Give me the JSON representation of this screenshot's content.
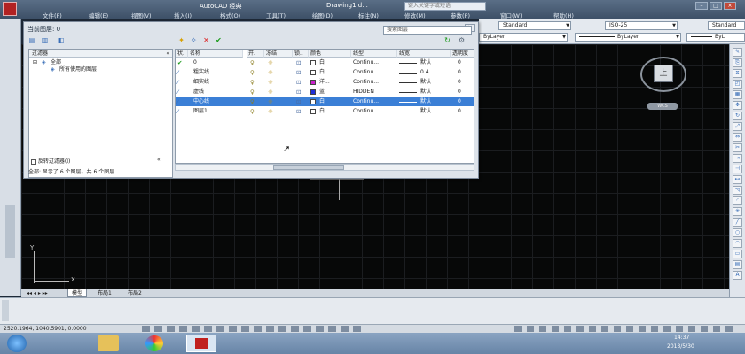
{
  "app": {
    "title": "AutoCAD 经典",
    "document": "Drawing1.d...",
    "search_placeholder": "键入关键字或短语",
    "menus": [
      "文件(F)",
      "编辑(E)",
      "视图(V)",
      "插入(I)",
      "格式(O)",
      "工具(T)",
      "绘图(D)",
      "标注(N)",
      "修改(M)",
      "参数(P)",
      "窗口(W)",
      "帮助(H)"
    ]
  },
  "toolbar": {
    "text_style": "Standard",
    "dim_style": "ISO-25",
    "extra_style": "Standard",
    "layer_color": "ByLayer",
    "linetype": "ByLayer",
    "lineweight": "ByL"
  },
  "dialog": {
    "title": "当前图层: 0",
    "search_placeholder": "搜索图层",
    "tree_header": "过滤器",
    "tree_items": [
      "全部",
      "所有使用的图层"
    ],
    "invert_filter": "反转过滤器(I)",
    "status": "全部: 显示了 6 个图层，共 6 个图层",
    "columns": [
      "状.",
      "名称",
      "开.",
      "冻结",
      "锁..",
      "颜色",
      "线型",
      "线宽",
      "透明度"
    ],
    "rows": [
      {
        "name": "0",
        "color_name": "白",
        "swatch": "#ffffff",
        "linetype": "Continu...",
        "lineweight": "默认",
        "transparency": "0",
        "selected": false,
        "current": true
      },
      {
        "name": "粗实线",
        "color_name": "白",
        "swatch": "#ffffff",
        "linetype": "Continu...",
        "lineweight": "0.4...",
        "transparency": "0",
        "selected": false,
        "current": false
      },
      {
        "name": "细实线",
        "color_name": "洋...",
        "swatch": "#cc22cc",
        "linetype": "Continu...",
        "lineweight": "默认",
        "transparency": "0",
        "selected": false,
        "current": false
      },
      {
        "name": "虚线",
        "color_name": "蓝",
        "swatch": "#1f2fd8",
        "linetype": "HIDDEN",
        "lineweight": "默认",
        "transparency": "0",
        "selected": false,
        "current": false
      },
      {
        "name": "中心线",
        "color_name": "白",
        "swatch": "#ffffff",
        "linetype": "Continu...",
        "lineweight": "默认",
        "transparency": "0",
        "selected": true,
        "current": false
      },
      {
        "name": "图层1",
        "color_name": "白",
        "swatch": "#ffffff",
        "linetype": "Continu...",
        "lineweight": "默认",
        "transparency": "0",
        "selected": false,
        "current": false
      }
    ]
  },
  "viewcube": {
    "face": "上",
    "wcs": "WCS"
  },
  "layout_tabs": [
    "模型",
    "布局1",
    "布局2"
  ],
  "statusbar": {
    "coords": "2520.1964, 1040.5901, 0.0000"
  },
  "taskbar": {
    "time": "14:37",
    "date": "2013/5/30"
  }
}
